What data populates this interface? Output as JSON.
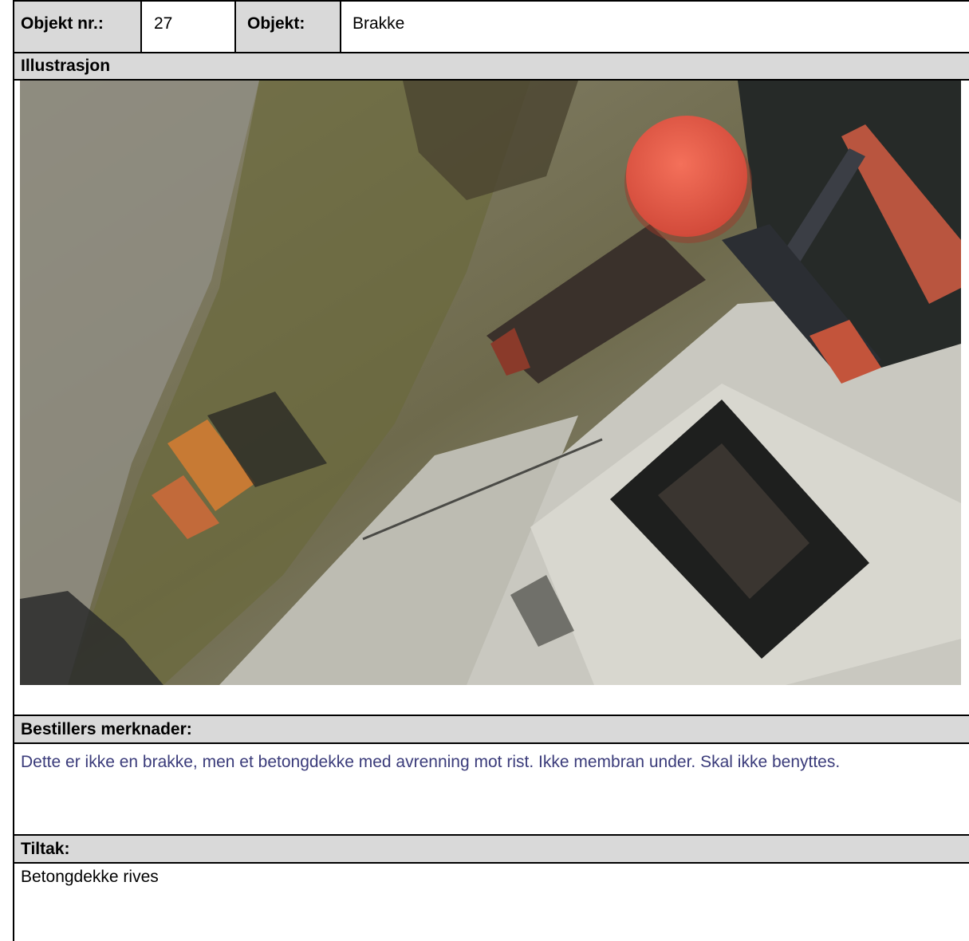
{
  "header": {
    "object_nr_label": "Objekt nr.:",
    "object_nr_value": "27",
    "object_label": "Objekt:",
    "object_value": "Brakke"
  },
  "illustration": {
    "heading": "Illustrasjon"
  },
  "remarks": {
    "heading": "Bestillers merknader:",
    "text": "Dette er ikke en brakke, men et betongdekke med avrenning mot rist. Ikke membran under. Skal ikke benyttes."
  },
  "measures": {
    "heading": "Tiltak:",
    "text": "Betongdekke rives"
  },
  "colors": {
    "header_band": "#d9d9d9",
    "remark_text": "#3a3b7a"
  }
}
